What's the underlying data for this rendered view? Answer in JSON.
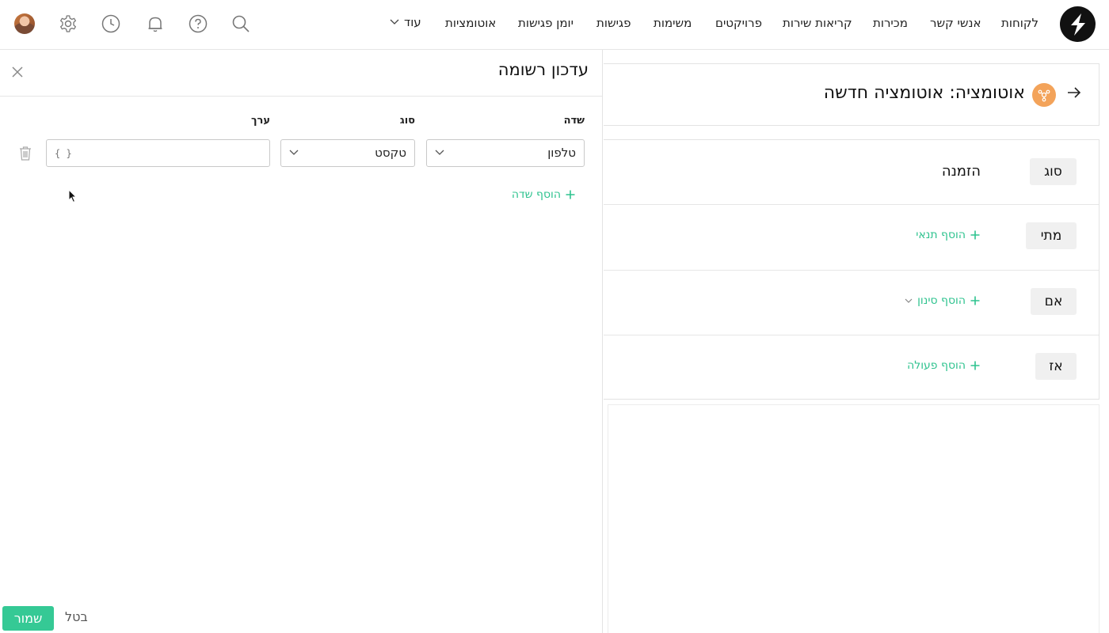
{
  "nav": {
    "items": [
      "לקוחות",
      "אנשי קשר",
      "מכירות",
      "קריאות שירות",
      "פרויקטים",
      "משימות",
      "פגישות",
      "יומן פגישות",
      "אוטומציות"
    ],
    "more_label": "עוד"
  },
  "icons": {
    "logo": "bolt-logo-icon",
    "search": "search-icon",
    "help": "help-icon",
    "notifications": "bell-icon",
    "history": "clock-icon",
    "settings": "gear-icon",
    "avatar": "user-avatar"
  },
  "colors": {
    "accent": "#2fc38f",
    "save_button": "#35c995",
    "badge": "#f3a35a",
    "tag_bg": "#f0f0f0"
  },
  "drawer": {
    "title": "עדכון רשומה",
    "columns": {
      "field": "שדה",
      "type": "סוג",
      "value": "ערך"
    },
    "row": {
      "field": "טלפון",
      "type": "טקסט",
      "value_placeholder": "{ }"
    },
    "add_field": "הוסף שדה",
    "save": "שמור",
    "cancel": "בטל"
  },
  "automation": {
    "title": "אוטומציה: אוטומציה חדשה",
    "rows": {
      "type": {
        "tag": "סוג",
        "value": "הזמנה"
      },
      "when": {
        "tag": "מתי",
        "action": "הוסף תנאי"
      },
      "if": {
        "tag": "אם",
        "action": "הוסף סינון"
      },
      "then": {
        "tag": "אז",
        "action": "הוסף פעולה"
      }
    }
  }
}
